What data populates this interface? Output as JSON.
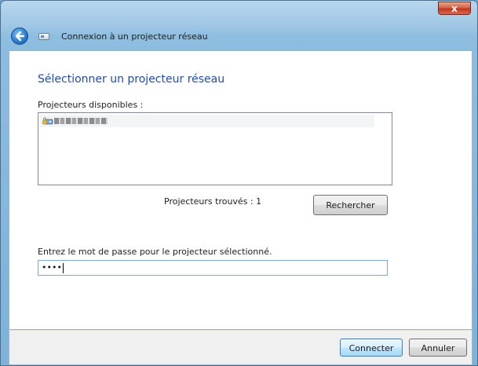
{
  "window": {
    "title": "Connexion à un projecteur réseau",
    "close_label": "x"
  },
  "main": {
    "heading": "Sélectionner un projecteur réseau",
    "available_label": "Projecteurs disponibles :",
    "projectors": [
      {
        "name": "",
        "icon": "network-projector-lock-icon",
        "selected": true
      }
    ],
    "found_text": "Projecteurs trouvés : 1",
    "search_label": "Rechercher",
    "password_label": "Entrez le mot de passe pour le projecteur sélectionné.",
    "password_value": "••••"
  },
  "footer": {
    "connect_label": "Connecter",
    "cancel_label": "Annuler"
  }
}
